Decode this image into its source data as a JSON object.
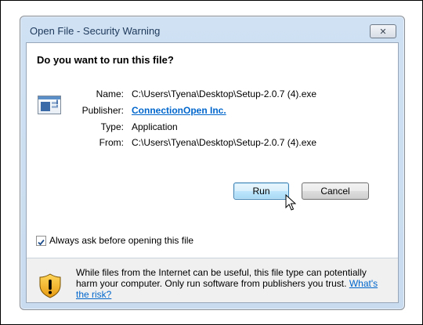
{
  "window": {
    "title": "Open File - Security Warning",
    "close_label": "✕"
  },
  "question": "Do you want to run this file?",
  "file": {
    "icon": "exe-file-icon",
    "fields": [
      {
        "label": "Name:",
        "value": "C:\\Users\\Tyena\\Desktop\\Setup-2.0.7 (4).exe"
      },
      {
        "label": "Publisher:",
        "value": "ConnectionOpen Inc."
      },
      {
        "label": "Type:",
        "value": "Application"
      },
      {
        "label": "From:",
        "value": "C:\\Users\\Tyena\\Desktop\\Setup-2.0.7 (4).exe"
      }
    ]
  },
  "buttons": {
    "run": "Run",
    "cancel": "Cancel"
  },
  "checkbox": {
    "label": "Always ask before opening this file",
    "checked": true
  },
  "warning": {
    "icon": "security-shield-icon",
    "text": "While files from the Internet can be useful, this file type can potentially harm your computer. Only run software from publishers you trust. ",
    "link": "What's the risk?"
  },
  "colors": {
    "link": "#0066cc",
    "title": "#1e395b",
    "frame": "#c9dcef"
  }
}
